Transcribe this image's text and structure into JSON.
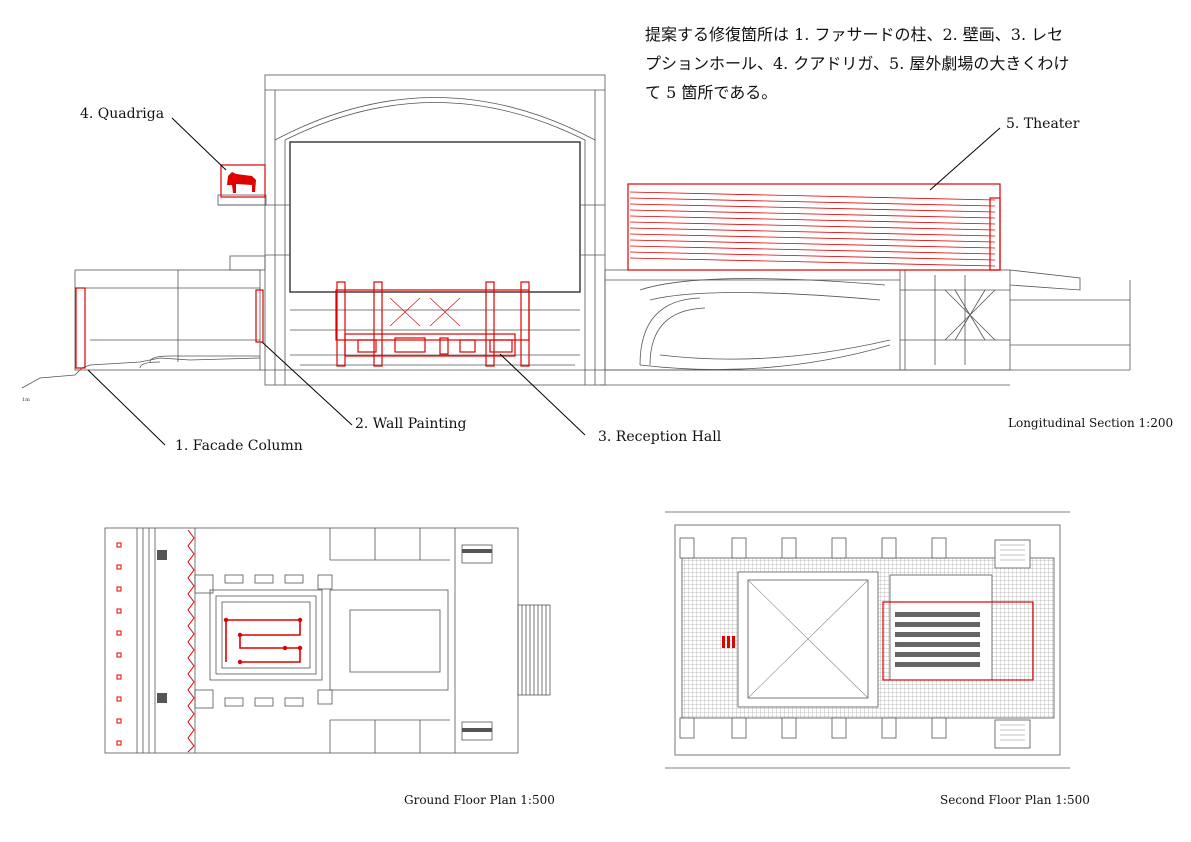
{
  "note": {
    "lines": [
      "提案する修復箇所は 1. ファサードの柱、2. 壁画、3. レセ",
      "プションホール、4. クアドリガ、5. 屋外劇場の大きくわけ",
      "て 5 箇所である。"
    ]
  },
  "labels": {
    "quadriga": "4. Quadriga",
    "theater": "5. Theater",
    "facade_column": "1. Facade Column",
    "wall_painting": "2. Wall Painting",
    "reception_hall": "3. Reception Hall"
  },
  "captions": {
    "section": "Longitudinal Section 1:200",
    "ground_plan": "Ground Floor Plan 1:500",
    "second_plan": "Second Floor Plan 1:500"
  },
  "colors": {
    "line": "#555555",
    "highlight": "#e00000",
    "text": "#111111"
  }
}
